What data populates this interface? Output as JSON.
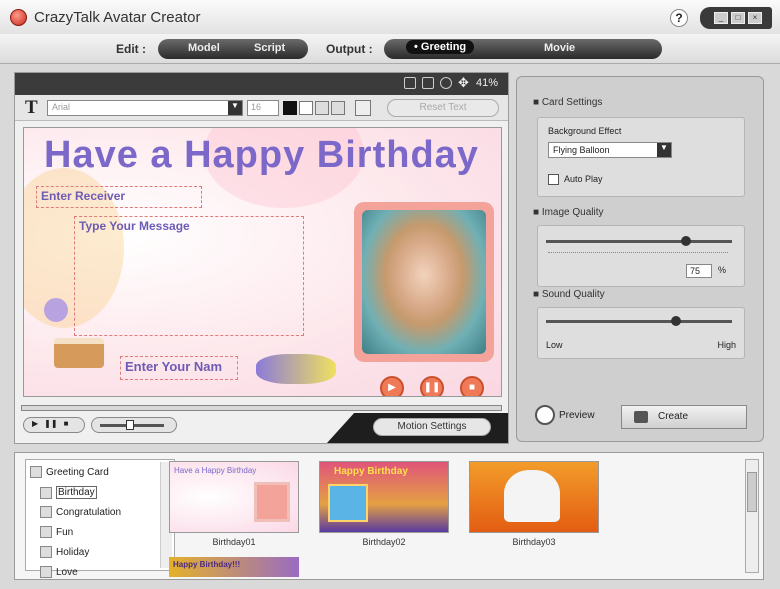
{
  "window": {
    "title": "CrazyTalk Avatar Creator",
    "help": "?"
  },
  "menu": {
    "edit_label": "Edit :",
    "model": "Model",
    "script": "Script",
    "output_label": "Output :",
    "greeting": "• Greeting",
    "movie": "Movie"
  },
  "viewer": {
    "zoom": "41%"
  },
  "texttools": {
    "bold_t": "T",
    "font": "Arial",
    "size": "16",
    "reset": "Reset Text"
  },
  "card": {
    "title": "Have a Happy Birthday",
    "receiver": "Enter Receiver",
    "message": "Type Your Message",
    "name": "Enter Your Nam"
  },
  "transport": {
    "motion_settings": "Motion Settings"
  },
  "right": {
    "card_settings": "Card Settings",
    "background_effect_label": "Background Effect",
    "background_effect_value": "Flying Balloon",
    "auto_play": "Auto Play",
    "image_quality": "Image Quality",
    "image_quality_value": "75",
    "percent": "%",
    "image_quality_level": 0.75,
    "sound_quality": "Sound Quality",
    "low": "Low",
    "high": "High",
    "sound_quality_level": 0.7,
    "preview": "Preview",
    "create": "Create"
  },
  "library": {
    "tree": [
      "Greeting Card",
      "Birthday",
      "Congratulation",
      "Fun",
      "Holiday",
      "Love"
    ],
    "thumbs": [
      "Birthday01",
      "Birthday02",
      "Birthday03"
    ],
    "thumb1_text": "Have a Happy Birthday",
    "thumb2_text": "Happy Birthday",
    "thumb4_text": "Happy Birthday!!!"
  }
}
